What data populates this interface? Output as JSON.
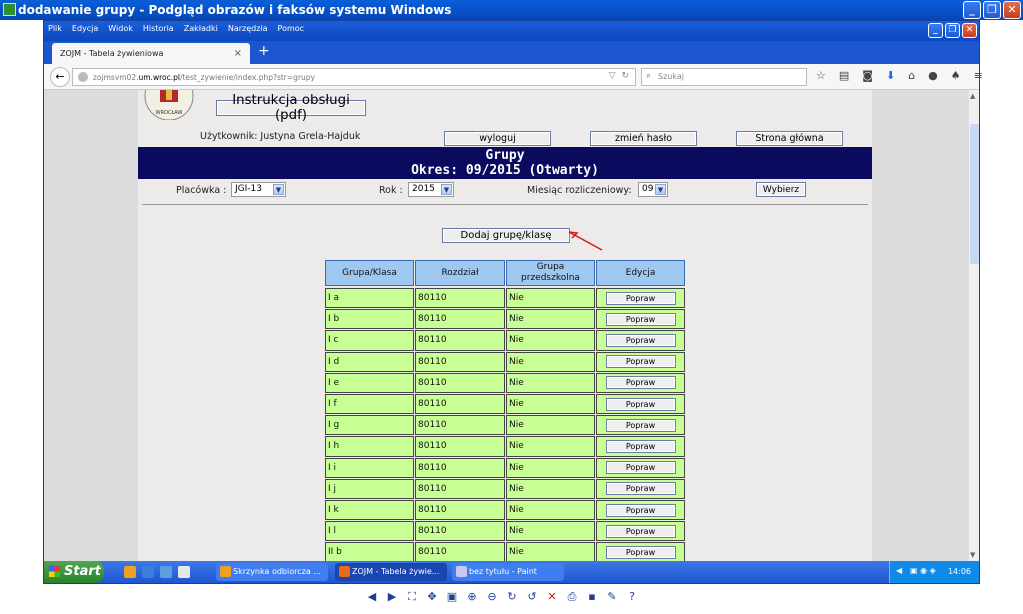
{
  "viewer": {
    "title": "dodawanie grupy - Podgląd obrazów i faksów systemu Windows",
    "toolbar_icons": [
      "previous-icon",
      "next-icon",
      "best-fit-icon",
      "actual-size-icon",
      "slideshow-icon",
      "zoom-in-icon",
      "zoom-out-icon",
      "rotate-clockwise-icon",
      "rotate-counterclockwise-icon",
      "delete-icon",
      "print-icon",
      "save-icon",
      "edit-icon",
      "help-icon"
    ]
  },
  "firefox": {
    "menu": [
      "Plik",
      "Edycja",
      "Widok",
      "Historia",
      "Zakładki",
      "Narzędzia",
      "Pomoc"
    ],
    "tab_title": "ZOJM - Tabela żywieniowa",
    "url_prefix": "zojmsvm02.",
    "url_host": "um.wroc.pl",
    "url_path": "/test_zywienie/index.php?str=grupy",
    "search_placeholder": "Szukaj"
  },
  "page": {
    "logo_text": "WROCŁAW",
    "pdf_button": "Instrukcja obsługi (pdf)",
    "user_label": "Użytkownik: Justyna Grela-Hajduk",
    "logout": "wyloguj",
    "change_password": "zmień hasło",
    "home": "Strona główna",
    "banner_title": "Grupy",
    "banner_period": "Okres: 09/2015 (Otwarty)",
    "facility_label": "Placówka :",
    "facility_value": "JGI-13",
    "year_label": "Rok :",
    "year_value": "2015",
    "month_label": "Miesiąc rozliczeniowy:",
    "month_value": "09",
    "choose_button": "Wybierz",
    "add_group_button": "Dodaj grupę/klasę",
    "columns": [
      "Grupa/Klasa",
      "Rozdział",
      "Grupa przedszkolna",
      "Edycja"
    ],
    "edit_label": "Popraw",
    "rows": [
      {
        "klasa": "I a",
        "rozdzial": "80110",
        "przedszkolna": "Nie"
      },
      {
        "klasa": "I b",
        "rozdzial": "80110",
        "przedszkolna": "Nie"
      },
      {
        "klasa": "I c",
        "rozdzial": "80110",
        "przedszkolna": "Nie"
      },
      {
        "klasa": "I d",
        "rozdzial": "80110",
        "przedszkolna": "Nie"
      },
      {
        "klasa": "I e",
        "rozdzial": "80110",
        "przedszkolna": "Nie"
      },
      {
        "klasa": "I f",
        "rozdzial": "80110",
        "przedszkolna": "Nie"
      },
      {
        "klasa": "I g",
        "rozdzial": "80110",
        "przedszkolna": "Nie"
      },
      {
        "klasa": "I h",
        "rozdzial": "80110",
        "przedszkolna": "Nie"
      },
      {
        "klasa": "I i",
        "rozdzial": "80110",
        "przedszkolna": "Nie"
      },
      {
        "klasa": "I j",
        "rozdzial": "80110",
        "przedszkolna": "Nie"
      },
      {
        "klasa": "I k",
        "rozdzial": "80110",
        "przedszkolna": "Nie"
      },
      {
        "klasa": "I l",
        "rozdzial": "80110",
        "przedszkolna": "Nie"
      },
      {
        "klasa": "II b",
        "rozdzial": "80110",
        "przedszkolna": "Nie"
      }
    ]
  },
  "taskbar": {
    "start": "Start",
    "tasks": [
      "Skrzynka odbiorcza ...",
      "ZOJM - Tabela żywie...",
      "bez tytułu - Paint"
    ],
    "clock": "14:06"
  },
  "colors": {
    "accent": "#0a0a5e",
    "row_bg": "#c8ff94",
    "header_bg": "#9ec8f0",
    "arrow": "#d11a1a"
  }
}
